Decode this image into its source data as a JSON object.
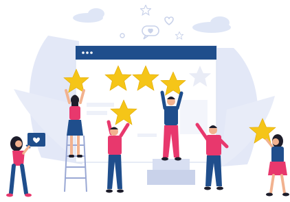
{
  "illustration": {
    "rating": {
      "filled_stars": 4,
      "total_stars": 5
    },
    "colors": {
      "star": "#f5c518",
      "star_stroke": "#e0a800",
      "empty_star": "#e9ecf6",
      "browser_bar": "#1f4e8c",
      "browser_body": "#ffffff",
      "background_leaves": "#e3e8f7",
      "cloud": "#dfe6f6",
      "pink": "#e8386d",
      "navy": "#1f4e8c",
      "skin": "#f2b28f",
      "hair": "#1d1d2b"
    },
    "icons": [
      "heart-icon",
      "star-icon",
      "cloud-icon",
      "speech-bubble-icon"
    ]
  }
}
